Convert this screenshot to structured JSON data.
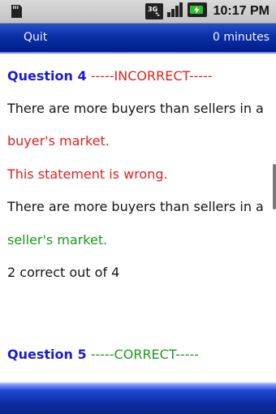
{
  "status_bar": {
    "time": "10:17 PM",
    "network": "3G",
    "icons": [
      "sd-card-icon",
      "network-3g-icon",
      "signal-icon",
      "battery-icon"
    ]
  },
  "title_bar": {
    "quit_label": "Quit",
    "timer_label": "0 minutes"
  },
  "question4": {
    "label": "Question 4",
    "result": "-----INCORRECT-----",
    "statement_line1": "There are more buyers than sellers in a",
    "statement_line2": "buyer's market.",
    "verdict": "This statement is wrong.",
    "correction_line1": "There are more buyers than sellers in a",
    "correction_line2": "seller's market.",
    "score": "2 correct out of 4"
  },
  "question5": {
    "label": "Question 5",
    "result": "-----CORRECT-----"
  },
  "colors": {
    "question_label": "#1a1ad6",
    "incorrect": "#e02020",
    "correct": "#1a9a1a",
    "bar_blue": "#0a2fa8"
  }
}
